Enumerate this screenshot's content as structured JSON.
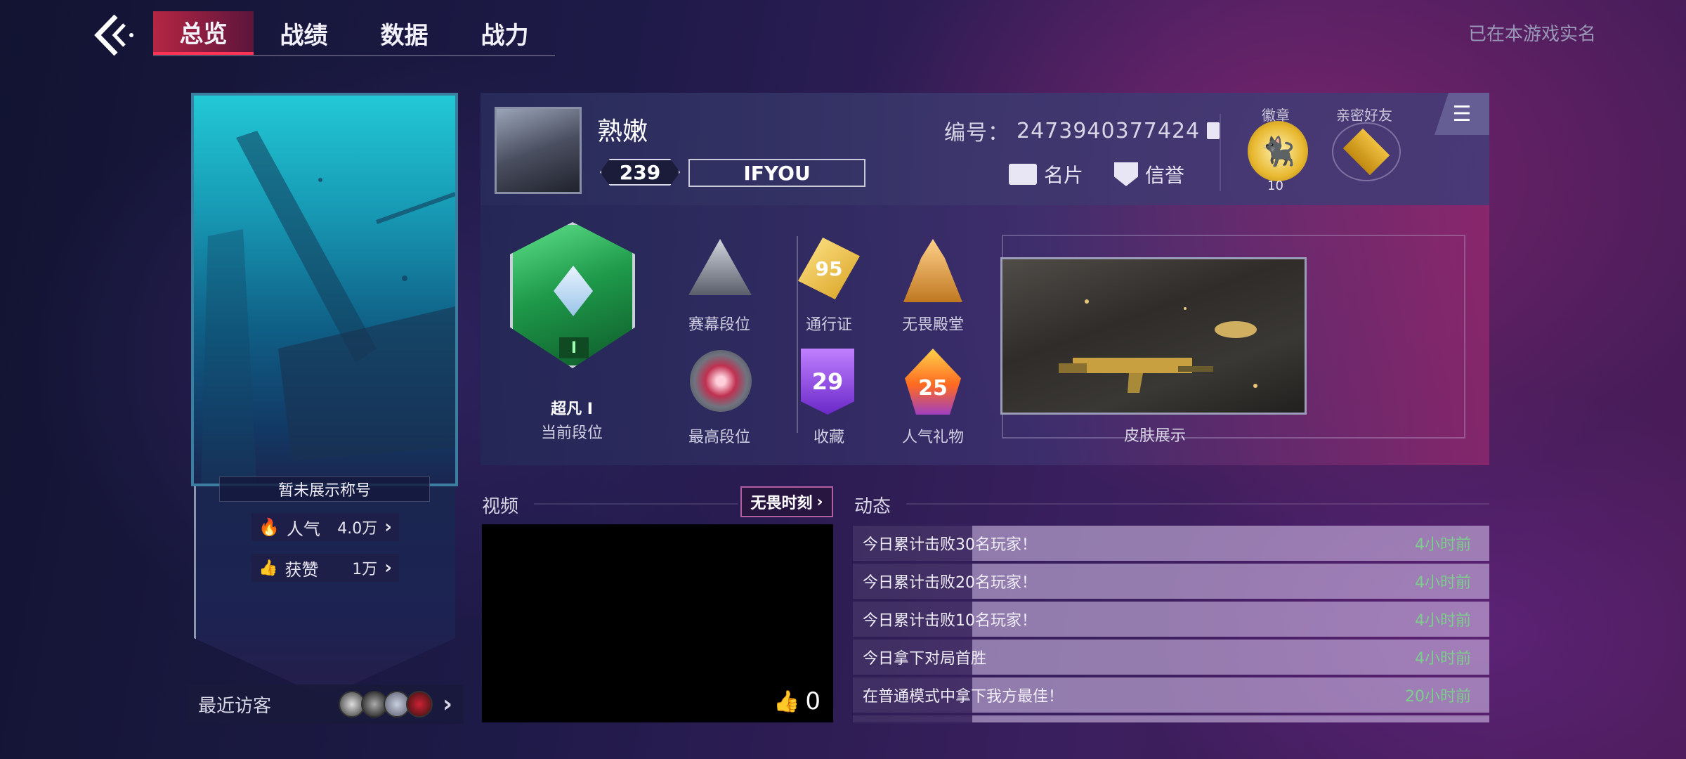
{
  "nav": {
    "tabs": [
      {
        "label": "总览",
        "active": true
      },
      {
        "label": "战绩",
        "active": false
      },
      {
        "label": "数据",
        "active": false
      },
      {
        "label": "战力",
        "active": false
      }
    ],
    "realname_text": "已在本游戏实名"
  },
  "banner": {
    "title_text": "暂未展示称号",
    "popularity_label": "人气",
    "popularity_value": "4.0万",
    "likes_label": "获赞",
    "likes_value": "1万",
    "visitors_label": "最近访客"
  },
  "profile": {
    "nickname": "熟嫩",
    "level": "239",
    "clan": "IFYOU",
    "uid_label": "编号：",
    "uid_value": "2473940377424",
    "namecard_label": "名片",
    "credit_label": "信誉",
    "badge_label": "徽章",
    "badge_count": "10",
    "friends_label": "亲密好友"
  },
  "achievements": {
    "rank_name": "超凡 I",
    "rank_label": "当前段位",
    "rank_numeral": "I",
    "items": [
      {
        "label": "赛幕段位"
      },
      {
        "label": "通行证",
        "value": "95"
      },
      {
        "label": "无畏殿堂"
      },
      {
        "label": "最高段位"
      },
      {
        "label": "收藏",
        "value": "29"
      },
      {
        "label": "人气礼物",
        "value": "25"
      }
    ],
    "skin_label": "皮肤展示"
  },
  "video": {
    "section_title": "视频",
    "moment_button": "无畏时刻",
    "like_count": "0"
  },
  "feed": {
    "section_title": "动态",
    "rows": [
      {
        "text": "今日累计击败30名玩家！",
        "time": "4小时前"
      },
      {
        "text": "今日累计击败20名玩家！",
        "time": "4小时前"
      },
      {
        "text": "今日累计击败10名玩家！",
        "time": "4小时前"
      },
      {
        "text": "今日拿下对局首胜",
        "time": "4小时前"
      },
      {
        "text": "在普通模式中拿下我方最佳！",
        "time": "20小时前"
      }
    ]
  },
  "colors": {
    "accent_red": "#ff3355",
    "time_green": "#7ccf8a",
    "badge_gold": "#e8b830"
  }
}
